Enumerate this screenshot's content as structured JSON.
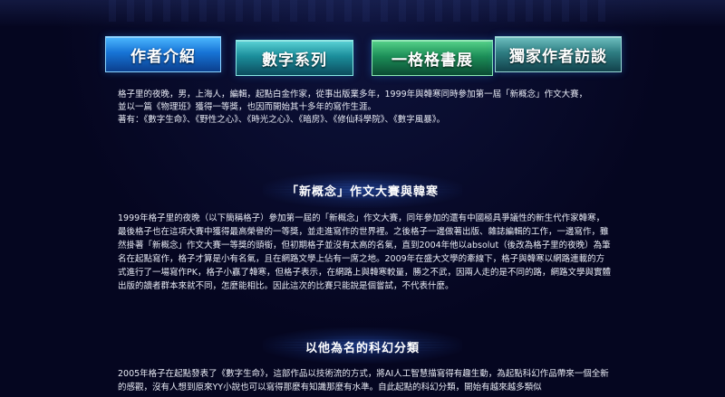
{
  "nav": {
    "tabs": [
      {
        "label": "作者介紹"
      },
      {
        "label": "數字系列"
      },
      {
        "label": "一格格書展"
      },
      {
        "label": "獨家作者訪談"
      }
    ]
  },
  "intro": {
    "line1": "格子里的夜晚，男，上海人，編輯，起點白金作家，從事出版業多年，1999年與韓寒同時參加第一屆「新概念」作文大賽，",
    "line2": "並以一篇《物理班》獲得一等獎，也因而開始其十多年的寫作生涯。",
    "line3": "著有：《數字生命》、《野性之心》、《時光之心》、《暗房》、《修仙科學院》、《數字風暴》。"
  },
  "section1": {
    "title": "「新概念」作文大賽與韓寒",
    "body": "1999年格子里的夜晚（以下簡稱格子）參加第一屆的「新概念」作文大賽，同年參加的還有中國極具爭議性的新生代作家韓寒，最後格子也在這項大賽中獲得最高榮譽的一等獎，並走進寫作的世界裡。之後格子一邊做著出版、雜誌編輯的工作，一邊寫作，雖然掛著「新概念」作文大賽一等獎的頭銜，但初期格子並沒有太高的名氣，直到2004年他以absolut（後改為格子里的夜晚）為筆名在起點寫作，格子才算是小有名氣，且在網路文學上佔有一席之地。2009年在盛大文學的牽線下，格子與韓寒以網路連載的方式進行了一場寫作PK，格子小贏了韓寒，但格子表示，在網路上與韓寒較量，勝之不武，因兩人走的是不同的路，網路文學與實體出版的讀者群本來就不同，怎麼能相比。因此這次的比賽只能說是個嘗試，不代表什麼。"
  },
  "section2": {
    "title": "以他為名的科幻分類",
    "body": "2005年格子在起點發表了《數字生命》，這部作品以技術流的方式，將AI人工智慧描寫得有趣生動，為起點科幻作品帶來一個全新的感觀，沒有人想到原來YY小說也可以寫得那麼有知識那麼有水準。自此起點的科幻分類，開始有越來越多類似"
  },
  "colors": {
    "background": "#050620",
    "tab_blue": "#1774d6",
    "tab_teal": "#1b8e9b",
    "tab_green": "#1c8f58",
    "tab_slate": "#2e7d82",
    "text": "#e8ebf5"
  }
}
